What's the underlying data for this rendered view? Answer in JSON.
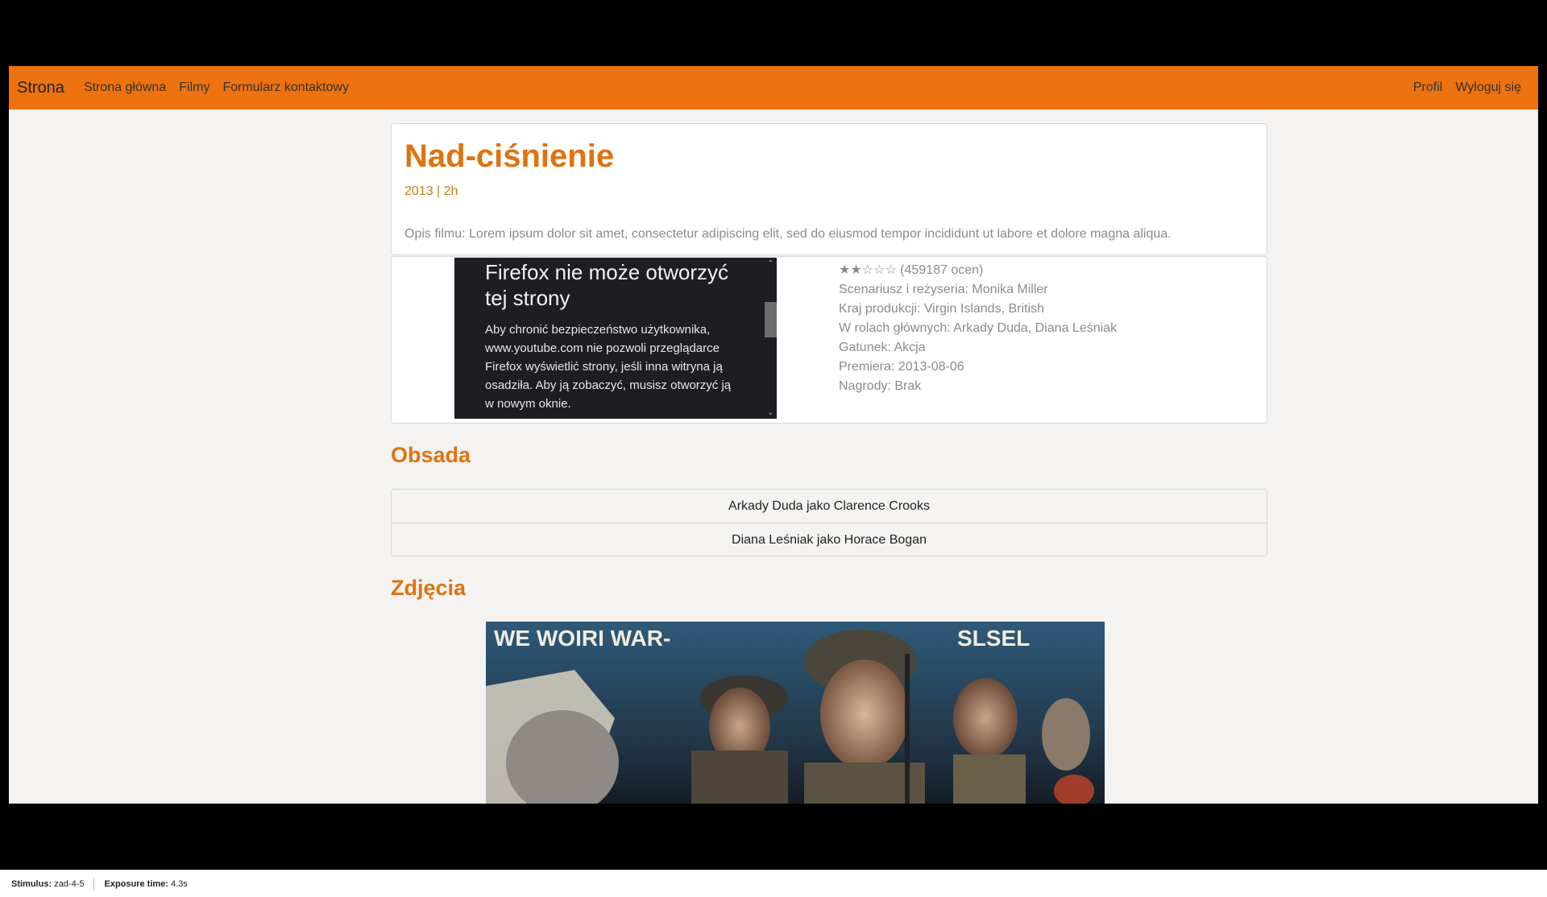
{
  "navbar": {
    "brand": "Strona",
    "links": [
      "Strona główna",
      "Filmy",
      "Formularz kontaktowy"
    ],
    "right_links": [
      "Profil",
      "Wyloguj się"
    ]
  },
  "movie": {
    "title": "Nad-ciśnienie",
    "meta": "2013 | 2h",
    "description": "Opis filmu: Lorem ipsum dolor sit amet, consectetur adipiscing elit, sed do eiusmod tempor incididunt ut labore et dolore magna aliqua."
  },
  "embed": {
    "heading": "Firefox nie może otworzyć tej strony",
    "text": "Aby chronić bezpieczeństwo użytkownika, www.youtube.com nie pozwoli przeglądarce Firefox wyświetlić strony, jeśli inna witryna ją osadziła. Aby ją zobaczyć, musisz otworzyć ją w nowym oknie."
  },
  "details": {
    "rating": "★★☆☆☆ (459187 ocen)",
    "director": "Scenariusz i reżyseria: Monika Miller",
    "country": "Kraj produkcji: Virgin Islands, British",
    "cast": "W rolach głównych: Arkady Duda, Diana Leśniak",
    "genre": "Gatunek: Akcja",
    "premiere": "Premiera: 2013-08-06",
    "awards": "Nagrody: Brak"
  },
  "sections": {
    "cast_title": "Obsada",
    "photos_title": "Zdjęcia"
  },
  "cast_list": [
    "Arkady Duda jako Clarence Crooks",
    "Diana Leśniak jako Horace Bogan"
  ],
  "photo": {
    "poster_text_left": "WE  WOIRI WAR-",
    "poster_text_right": "SLSEL"
  },
  "statusbar": {
    "stimulus_label": "Stimulus:",
    "stimulus_value": "zad-4-5",
    "exposure_label": "Exposure time:",
    "exposure_value": "4.3s"
  }
}
